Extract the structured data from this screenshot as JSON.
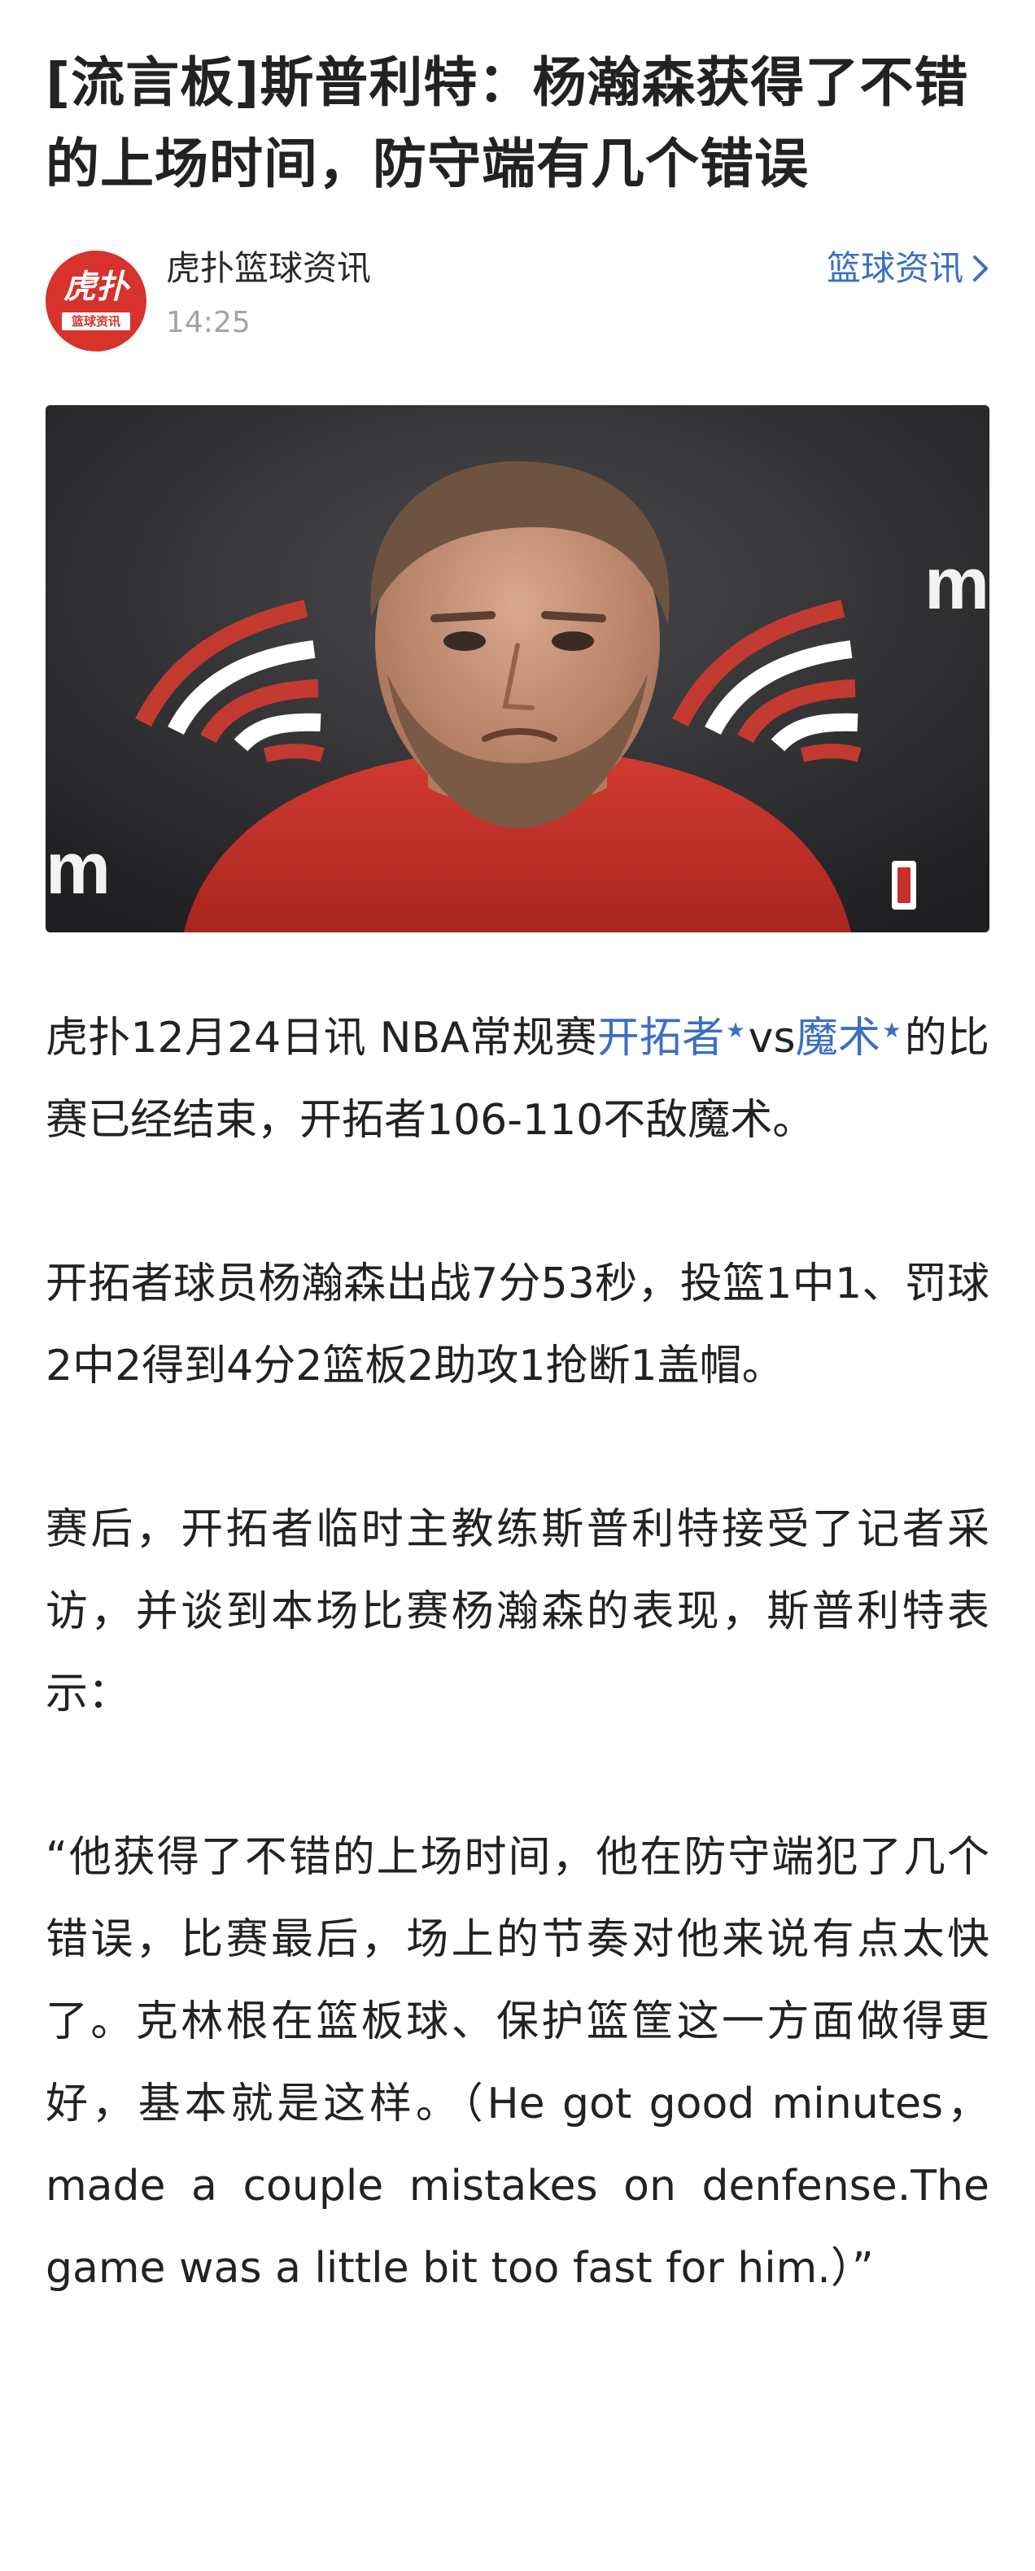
{
  "article": {
    "title": "[流言板]斯普利特：杨瀚森获得了不错的上场时间，防守端有几个错误",
    "author": {
      "name": "虎扑篮球资讯",
      "time": "14:25",
      "avatar_text": "虎扑",
      "avatar_subtext": "篮球资讯"
    },
    "channel_link": "篮球资讯",
    "hero_image": {
      "icon": "portrait-photo",
      "wall_text": "m"
    },
    "paragraph1": {
      "prefix": "虎扑12月24日讯 NBA常规赛",
      "team1": "开拓者",
      "vs": "vs",
      "team2": "魔术",
      "suffix": "的比赛已经结束，开拓者106-110不敌魔术。"
    },
    "paragraph2": "开拓者球员杨瀚森出战7分53秒，投篮1中1、罚球2中2得到4分2篮板2助攻1抢断1盖帽。",
    "paragraph3": "赛后，开拓者临时主教练斯普利特接受了记者采访，并谈到本场比赛杨瀚森的表现，斯普利特表示：",
    "paragraph4": "“他获得了不错的上场时间，他在防守端犯了几个错误，比赛最后，场上的节奏对他来说有点太快了。克林根在篮板球、保护篮筐这一方面做得更好，基本就是这样。（He got good minutes，made a couple mistakes on denfense.The game was a little bit too fast for him.）”"
  },
  "colors": {
    "link": "#3b6fc4",
    "brand_red": "#d7322b",
    "time_gray": "#a3a3a3"
  }
}
